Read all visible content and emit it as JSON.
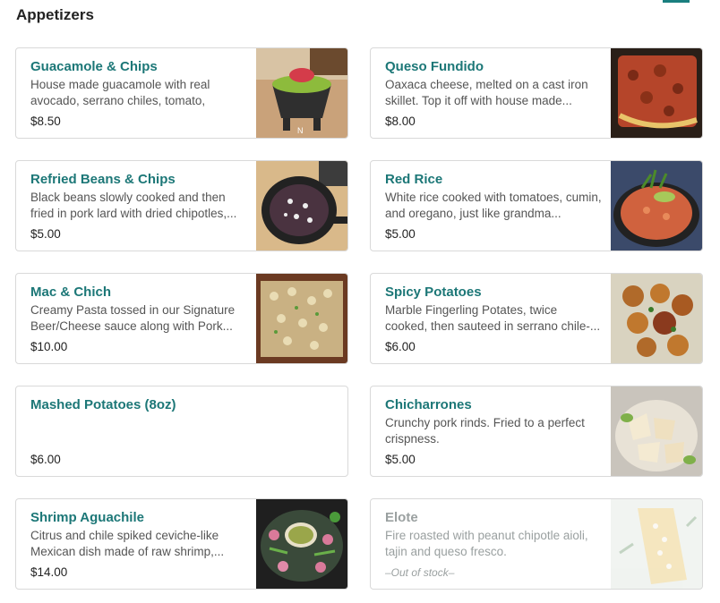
{
  "section": {
    "title": "Appetizers"
  },
  "items": [
    {
      "name": "Guacamole & Chips",
      "desc": "House made guacamole with real avocado, serrano chiles, tomato, onion,...",
      "price": "$8.50",
      "icon": "guacamole-image"
    },
    {
      "name": "Queso Fundido",
      "desc": "Oaxaca cheese, melted on a cast iron skillet. Top it off with house made...",
      "price": "$8.00",
      "icon": "queso-fundido-image"
    },
    {
      "name": "Refried Beans & Chips",
      "desc": "Black beans slowly cooked and then fried in pork lard with dried chipotles,...",
      "price": "$5.00",
      "icon": "refried-beans-image"
    },
    {
      "name": "Red Rice",
      "desc": "White rice cooked with tomatoes, cumin, and oregano, just like grandma...",
      "price": "$5.00",
      "icon": "red-rice-image"
    },
    {
      "name": "Mac & Chich",
      "desc": "Creamy Pasta tossed in our Signature Beer/Cheese sauce along with Pork...",
      "price": "$10.00",
      "icon": "mac-chich-image"
    },
    {
      "name": "Spicy Potatoes",
      "desc": "Marble Fingerling Potates, twice cooked, then sauteed in serrano chile-...",
      "price": "$6.00",
      "icon": "spicy-potatoes-image"
    },
    {
      "name": "Mashed Potatoes (8oz)",
      "desc": "",
      "price": "$6.00"
    },
    {
      "name": "Chicharrones",
      "desc": "Crunchy pork rinds. Fried to a perfect crispness.",
      "price": "$5.00",
      "icon": "chicharrones-image"
    },
    {
      "name": "Shrimp Aguachile",
      "desc": "Citrus and chile spiked ceviche-like Mexican dish made of raw shrimp,...",
      "price": "$14.00",
      "icon": "shrimp-aguachile-image"
    },
    {
      "name": "Elote",
      "desc": "Fire roasted with peanut chipotle aioli, tajin and queso fresco.",
      "price": "–Out of stock–",
      "icon": "elote-image",
      "status": "out-of-stock"
    }
  ]
}
